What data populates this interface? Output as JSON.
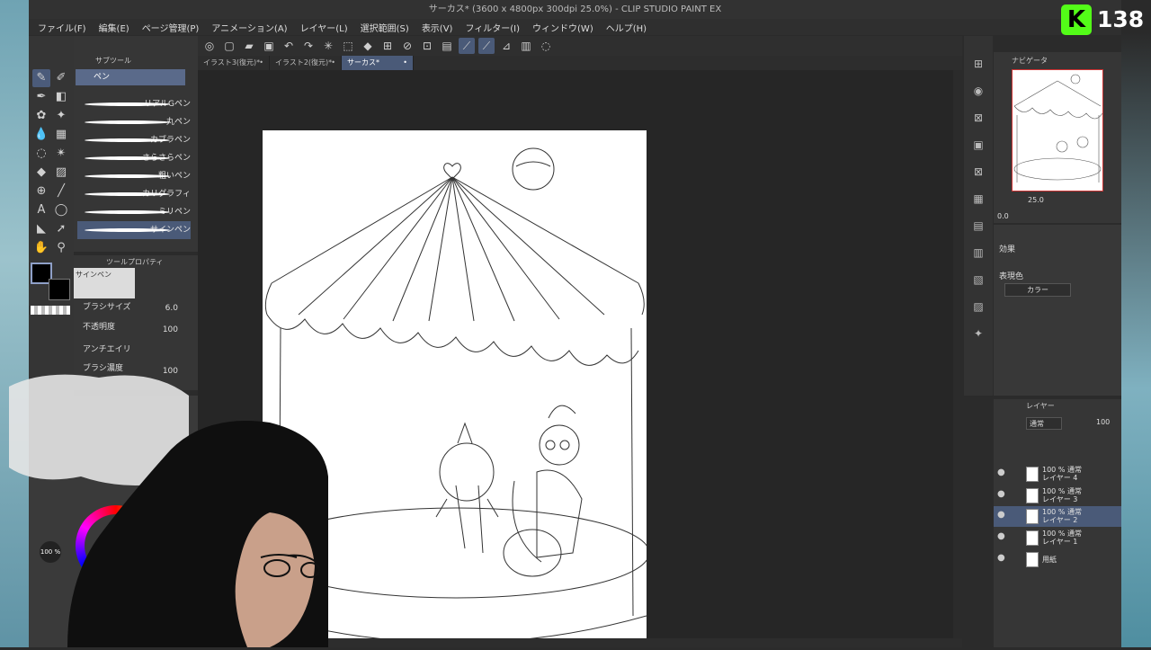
{
  "window": {
    "title": "サーカス* (3600 x 4800px 300dpi 25.0%)  - CLIP STUDIO PAINT EX"
  },
  "menu": [
    "ファイル(F)",
    "編集(E)",
    "ページ管理(P)",
    "アニメーション(A)",
    "レイヤー(L)",
    "選択範囲(S)",
    "表示(V)",
    "フィルター(I)",
    "ウィンドウ(W)",
    "ヘルプ(H)"
  ],
  "doc_tabs": [
    {
      "label": "イラスト3(復元)*",
      "active": false
    },
    {
      "label": "イラスト2(復元)*",
      "active": false
    },
    {
      "label": "サーカス*",
      "active": true
    }
  ],
  "subtool": {
    "header": "サブツール",
    "group": "ペン",
    "brushes": [
      "リアルGペン",
      "丸ペン",
      "カブラペン",
      "さらさらペン",
      "粗いペン",
      "カリグラフィ",
      "ミリペン",
      "サインペン"
    ]
  },
  "tool_property": {
    "header": "ツールプロパティ",
    "selected": "サインペン",
    "brush_size_label": "ブラシサイズ",
    "brush_size_value": "6.0",
    "opacity_label": "不透明度",
    "opacity_value": "100",
    "antialias_label": "アンチエイリ",
    "density_label": "ブラシ濃度",
    "density_value": "100"
  },
  "color_wheel": {
    "opacity_label": "100 %"
  },
  "navigator": {
    "title": "ナビゲータ",
    "zoom": "25.0",
    "angle": "0.0"
  },
  "effect": {
    "title": "効果",
    "expression_label": "表現色",
    "expression_value": "カラー"
  },
  "layers": {
    "title": "レイヤー",
    "blend": "通常",
    "opacity": "100",
    "items": [
      {
        "line1": "100 % 通常",
        "line2": "レイヤー 4",
        "active": false
      },
      {
        "line1": "100 % 通常",
        "line2": "レイヤー 3",
        "active": false
      },
      {
        "line1": "100 % 通常",
        "line2": "レイヤー 2",
        "active": true
      },
      {
        "line1": "100 % 通常",
        "line2": "レイヤー 1",
        "active": false
      },
      {
        "line1": "",
        "line2": "用紙",
        "active": false
      }
    ]
  },
  "stream_badge": {
    "letter": "K",
    "count": "138"
  },
  "colors": {
    "accent": "#4a5a78",
    "panel": "#363636",
    "canvas_bg": "#262626",
    "kick_green": "#53fc18"
  }
}
